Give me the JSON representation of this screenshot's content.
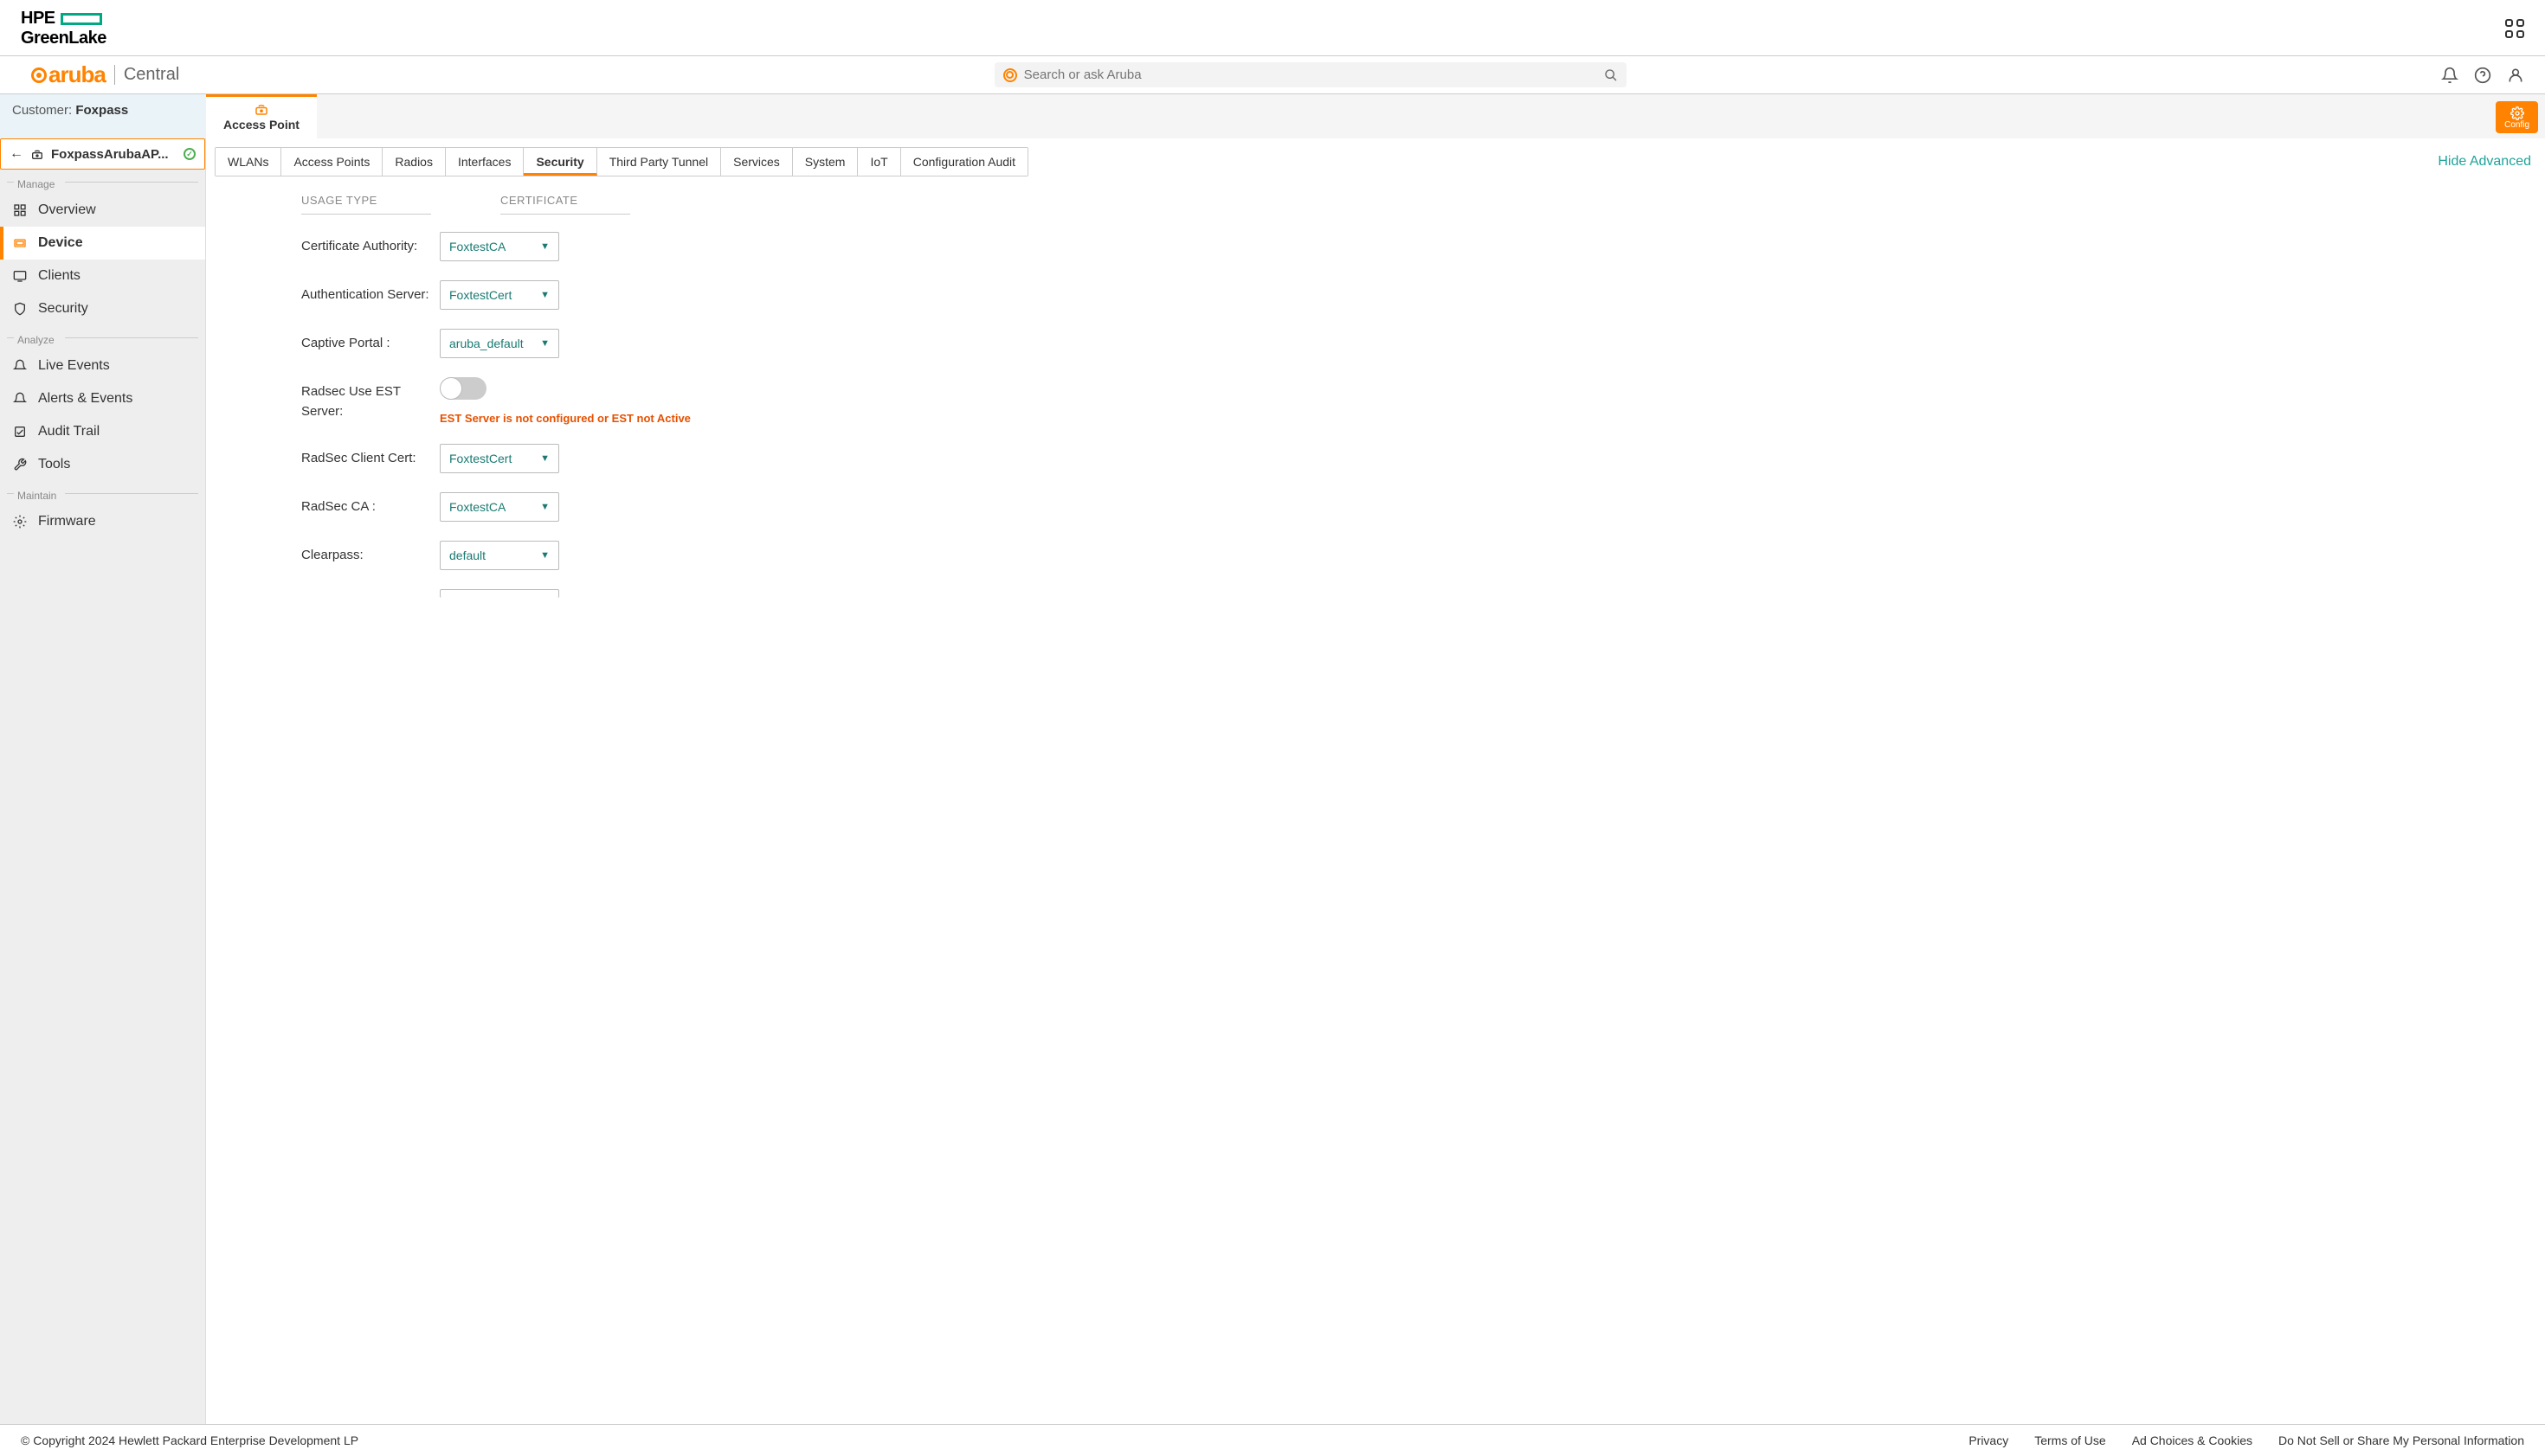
{
  "hpe": {
    "brand1": "HPE",
    "brand2": "GreenLake"
  },
  "aruba": {
    "brand": "aruba",
    "sub": "Central"
  },
  "search": {
    "placeholder": "Search or ask Aruba"
  },
  "customer": {
    "label": "Customer: ",
    "value": "Foxpass"
  },
  "apTab": {
    "label": "Access Point"
  },
  "configBtn": {
    "label": "Config"
  },
  "context": {
    "name": "FoxpassArubaAP..."
  },
  "sidebar": {
    "sections": {
      "manage": "Manage",
      "analyze": "Analyze",
      "maintain": "Maintain"
    },
    "items": {
      "overview": "Overview",
      "device": "Device",
      "clients": "Clients",
      "security": "Security",
      "liveEvents": "Live Events",
      "alerts": "Alerts & Events",
      "audit": "Audit Trail",
      "tools": "Tools",
      "firmware": "Firmware"
    }
  },
  "tabs": {
    "wlans": "WLANs",
    "aps": "Access Points",
    "radios": "Radios",
    "interfaces": "Interfaces",
    "security": "Security",
    "tpt": "Third Party Tunnel",
    "services": "Services",
    "system": "System",
    "iot": "IoT",
    "confAudit": "Configuration Audit"
  },
  "hideAdvanced": "Hide Advanced",
  "colHeaders": {
    "usage": "USAGE TYPE",
    "cert": "CERTIFICATE"
  },
  "form": {
    "ca": {
      "label": "Certificate Authority:",
      "value": "FoxtestCA"
    },
    "auth": {
      "label": "Authentication Server:",
      "value": "FoxtestCert"
    },
    "captive": {
      "label": "Captive Portal :",
      "value": "aruba_default"
    },
    "radsecEst": {
      "label": "Radsec Use EST Server:",
      "warning": "EST Server is not configured or EST not Active"
    },
    "radsecClient": {
      "label": "RadSec Client Cert:",
      "value": "FoxtestCert"
    },
    "radsecCa": {
      "label": "RadSec CA :",
      "value": "FoxtestCA"
    },
    "clearpass": {
      "label": "Clearpass:",
      "value": "default"
    }
  },
  "footer": {
    "copyright": "© Copyright 2024 Hewlett Packard Enterprise Development LP",
    "links": {
      "privacy": "Privacy",
      "terms": "Terms of Use",
      "ads": "Ad Choices & Cookies",
      "donotsell": "Do Not Sell or Share My Personal Information"
    }
  }
}
